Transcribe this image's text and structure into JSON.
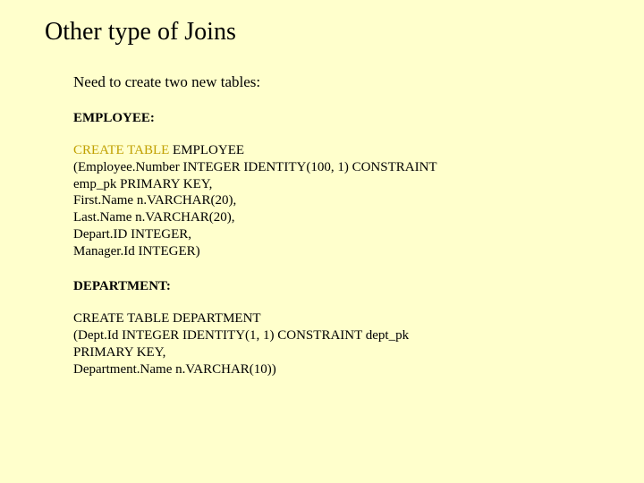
{
  "title": "Other type of Joins",
  "intro": "Need to create two new tables:",
  "employee": {
    "label": "EMPLOYEE:",
    "kw": "CREATE TABLE",
    "l1rest": " EMPLOYEE",
    "l2": "(Employee.Number INTEGER IDENTITY(100, 1) CONSTRAINT",
    "l3": "emp_pk PRIMARY KEY,",
    "l4": "First.Name n.VARCHAR(20),",
    "l5": "Last.Name n.VARCHAR(20),",
    "l6": "Depart.ID INTEGER,",
    "l7": "Manager.Id INTEGER)"
  },
  "department": {
    "label": "DEPARTMENT:",
    "l1": "CREATE TABLE DEPARTMENT",
    "l2": "(Dept.Id INTEGER IDENTITY(1, 1) CONSTRAINT dept_pk",
    "l3": "PRIMARY KEY,",
    "l4": "Department.Name n.VARCHAR(10))"
  }
}
